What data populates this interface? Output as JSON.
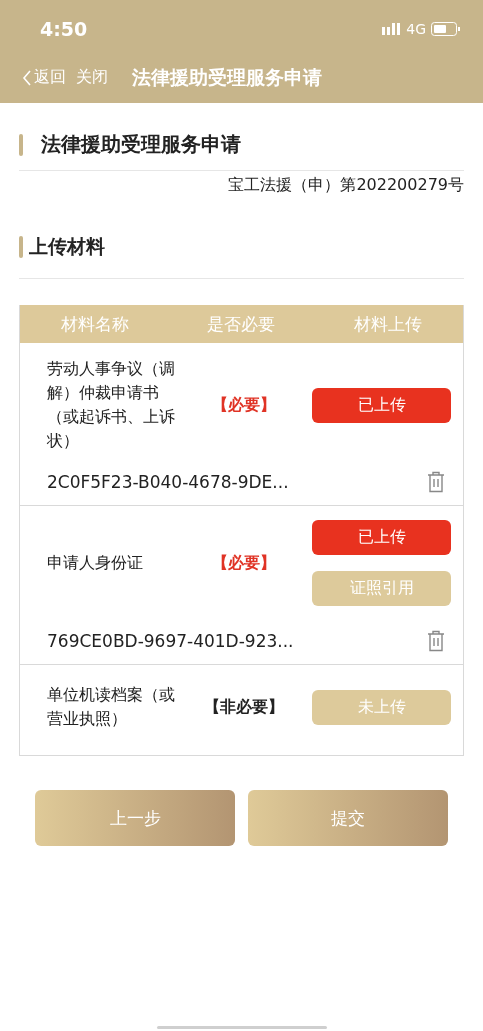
{
  "status_bar": {
    "time": "4:50",
    "network": "4G"
  },
  "nav_bar": {
    "back": "返回",
    "close": "关闭",
    "title": "法律援助受理服务申请"
  },
  "form_header": {
    "title": "法律援助受理服务申请",
    "case_number": "宝工法援（申）第202200279号"
  },
  "section": {
    "title": "上传材料"
  },
  "table": {
    "columns": [
      "材料名称",
      "是否必要",
      "材料上传"
    ],
    "rows": [
      {
        "name": "劳动人事争议（调解）仲裁申请书（或起诉书、上诉状）",
        "requirement": "【必要】",
        "required": true,
        "actions": [
          {
            "label": "已上传",
            "kind": "uploaded"
          }
        ],
        "file": "2C0F5F23-B040-4678-9DE..."
      },
      {
        "name": "申请人身份证",
        "requirement": "【必要】",
        "required": true,
        "actions": [
          {
            "label": "已上传",
            "kind": "uploaded"
          },
          {
            "label": "证照引用",
            "kind": "reference"
          }
        ],
        "file": "769CE0BD-9697-401D-923..."
      },
      {
        "name": "单位机读档案（或营业执照）",
        "requirement": "【非必要】",
        "required": false,
        "actions": [
          {
            "label": "未上传",
            "kind": "pending"
          }
        ]
      }
    ]
  },
  "buttons": [
    "上一步",
    "提交"
  ]
}
